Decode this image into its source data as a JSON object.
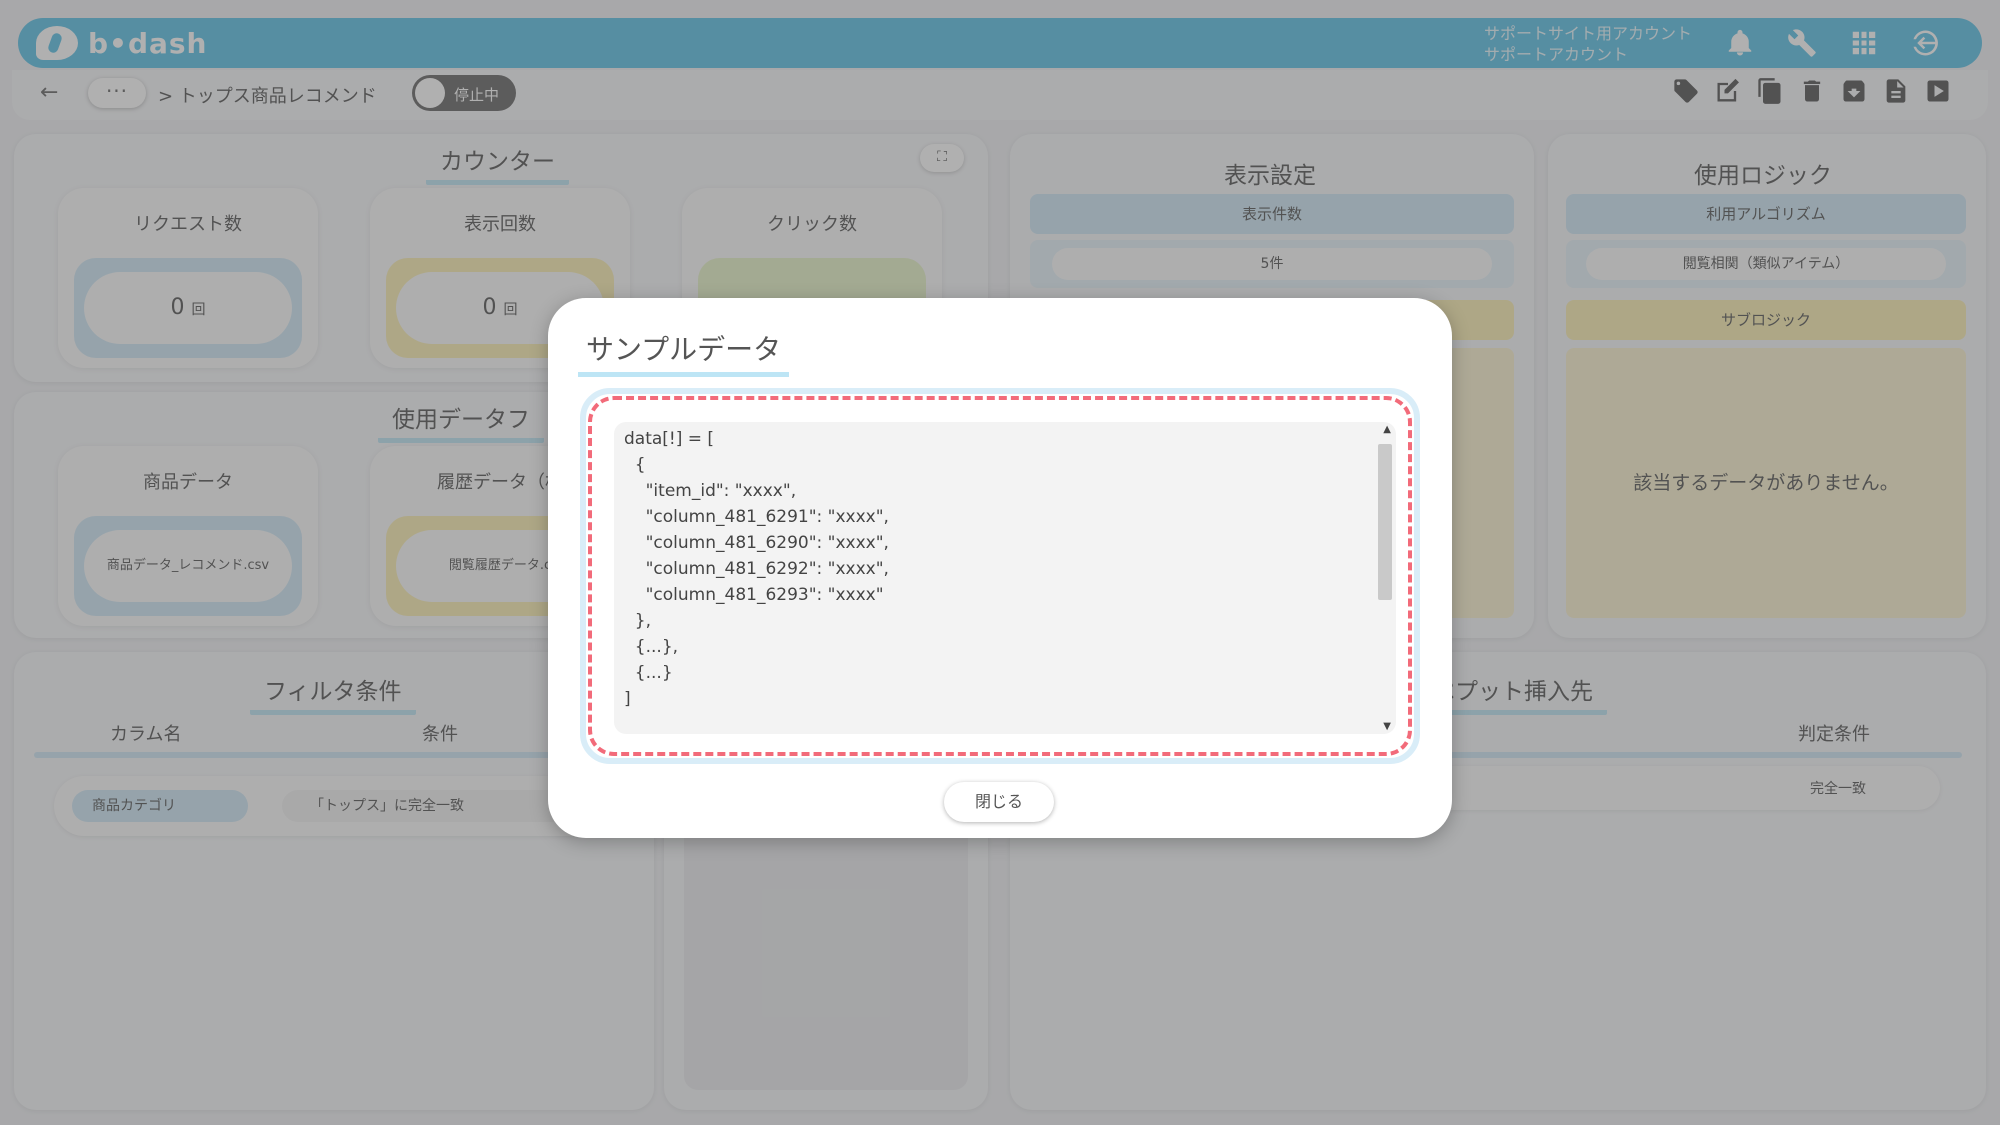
{
  "header": {
    "logo_text": "b•dash",
    "account_line1": "サポートサイト用アカウント",
    "account_line2": "サポートアカウント",
    "icons": [
      "bell-icon",
      "wrench-icon",
      "grid-icon",
      "logout-icon"
    ]
  },
  "subbar": {
    "back_icon": "←",
    "crumb_dots": "···",
    "crumb_text": "> トップス商品レコメンド",
    "toggle_label": "停止中",
    "actions": [
      "tag-icon",
      "edit-icon",
      "copy-icon",
      "trash-icon",
      "archive-icon",
      "document-icon",
      "play-icon"
    ]
  },
  "counter": {
    "title": "カウンター",
    "cards": [
      {
        "label": "リクエスト数",
        "value": "0",
        "unit": "回"
      },
      {
        "label": "表示回数",
        "value": "0",
        "unit": "回"
      },
      {
        "label": "クリック数",
        "value": "",
        "unit": ""
      }
    ]
  },
  "data_files": {
    "title": "使用データフ",
    "cards": [
      {
        "label": "商品データ",
        "value": "商品データ_レコメンド.csv"
      },
      {
        "label": "履歴データ（相",
        "value": "閲覧履歴データ.c"
      }
    ]
  },
  "filter": {
    "title": "フィルタ条件",
    "col_name": "カラム名",
    "col_cond": "条件",
    "row_name": "商品カテゴリ",
    "row_cond": "「トップス」に完全一致"
  },
  "display_settings": {
    "title": "表示設定",
    "bar_label": "表示件数",
    "value": "5件"
  },
  "logic": {
    "title": "使用ロジック",
    "algo_label": "利用アルゴリズム",
    "algo_value": "閲覧相関（類似アイテム）",
    "sub_label": "サブロジック",
    "empty": "該当するデータがありません。"
  },
  "snippet": {
    "title": "ペプット挿入先",
    "col_judge": "判定条件",
    "row_value": "完全一致"
  },
  "modal": {
    "title": "サンプルデータ",
    "code": "data[!] = [\n  {\n    \"item_id\": \"xxxx\",\n    \"column_481_6291\": \"xxxx\",\n    \"column_481_6290\": \"xxxx\",\n    \"column_481_6292\": \"xxxx\",\n    \"column_481_6293\": \"xxxx\"\n  },\n  {...},\n  {...}\n]",
    "close_label": "閉じる"
  }
}
